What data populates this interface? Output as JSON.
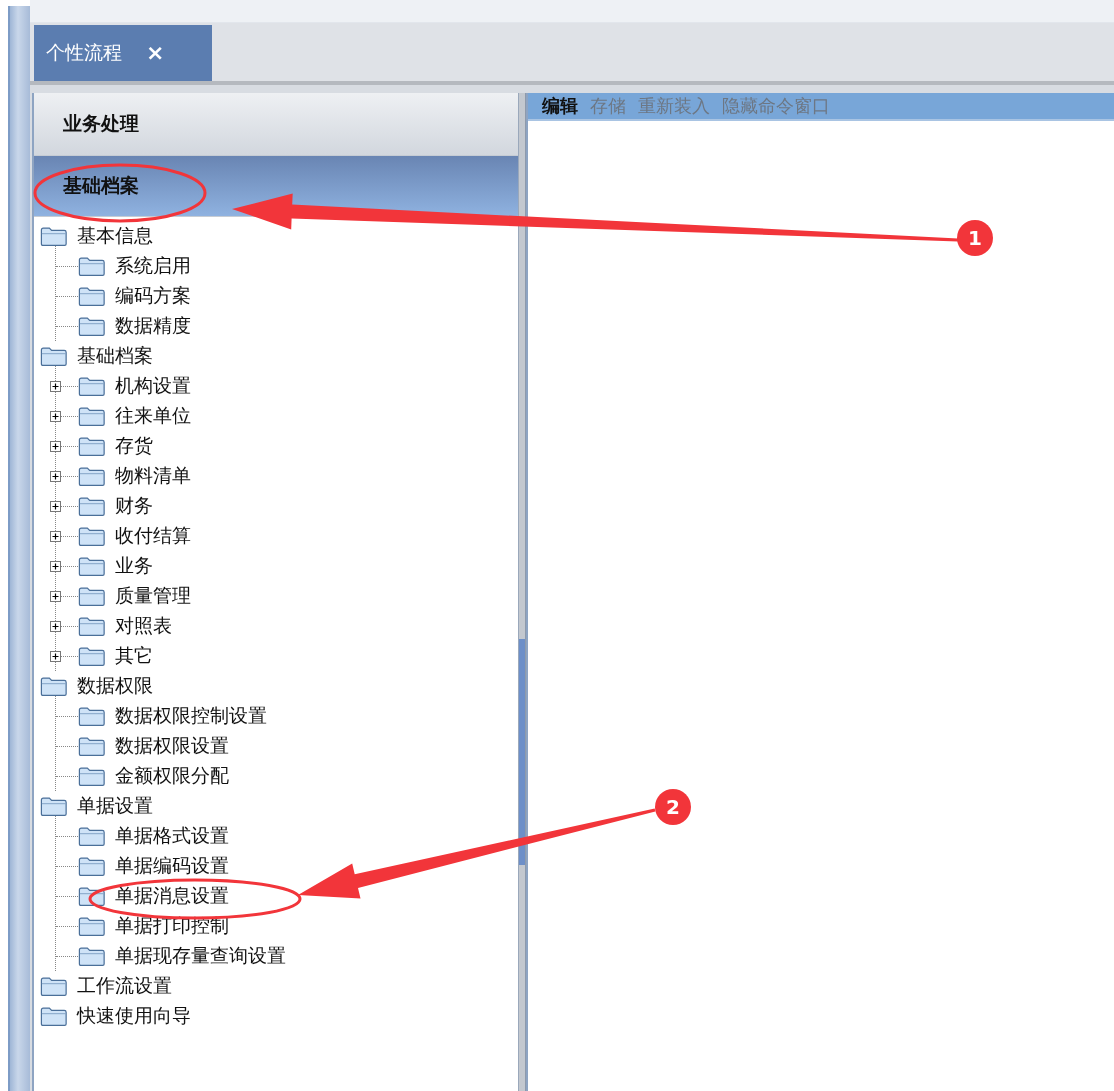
{
  "tabs": [
    {
      "label": "个性流程",
      "close": "×",
      "selected": true
    }
  ],
  "sidebar": {
    "sections": [
      {
        "label": "业务处理",
        "selected": false
      },
      {
        "label": "基础档案",
        "selected": true
      }
    ],
    "tree": [
      {
        "label": "基本信息",
        "children": [
          {
            "label": "系统启用"
          },
          {
            "label": "编码方案"
          },
          {
            "label": "数据精度"
          }
        ]
      },
      {
        "label": "基础档案",
        "children": [
          {
            "label": "机构设置",
            "expanded": false
          },
          {
            "label": "往来单位",
            "expanded": false
          },
          {
            "label": "存货",
            "expanded": false
          },
          {
            "label": "物料清单",
            "expanded": false
          },
          {
            "label": "财务",
            "expanded": false
          },
          {
            "label": "收付结算",
            "expanded": false
          },
          {
            "label": "业务",
            "expanded": false
          },
          {
            "label": "质量管理",
            "expanded": false
          },
          {
            "label": "对照表",
            "expanded": false
          },
          {
            "label": "其它",
            "expanded": false
          }
        ]
      },
      {
        "label": "数据权限",
        "children": [
          {
            "label": "数据权限控制设置"
          },
          {
            "label": "数据权限设置"
          },
          {
            "label": "金额权限分配"
          }
        ]
      },
      {
        "label": "单据设置",
        "children": [
          {
            "label": "单据格式设置"
          },
          {
            "label": "单据编码设置"
          },
          {
            "label": "单据消息设置"
          },
          {
            "label": "单据打印控制"
          },
          {
            "label": "单据现存量查询设置"
          }
        ]
      },
      {
        "label": "工作流设置"
      },
      {
        "label": "快速使用向导"
      }
    ]
  },
  "toolbar": [
    {
      "label": "编辑",
      "disabled": false
    },
    {
      "label": "存储",
      "disabled": true
    },
    {
      "label": "重新装入",
      "disabled": true
    },
    {
      "label": "隐藏命令窗口",
      "disabled": true
    }
  ],
  "annotations": [
    {
      "number": "1"
    },
    {
      "number": "2"
    }
  ]
}
